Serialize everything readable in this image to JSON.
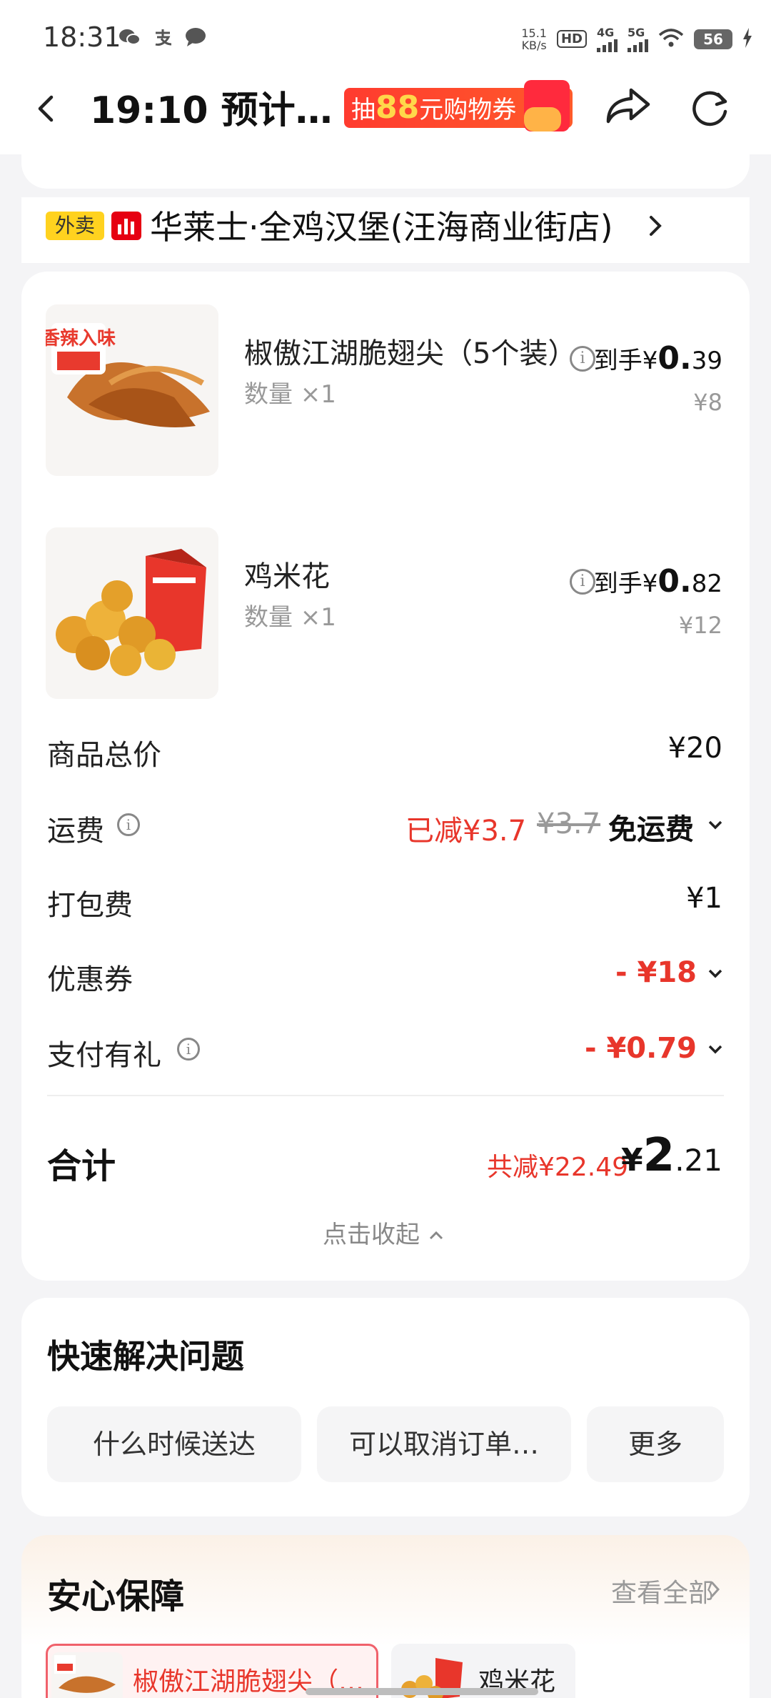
{
  "status_bar": {
    "time": "18:31",
    "net_speed_value": "15.1",
    "net_speed_unit": "KB/s",
    "hd_label": "HD",
    "sim1_label": "4G",
    "sim2_label": "5G",
    "battery": "56"
  },
  "nav": {
    "title": "19:10 预计…",
    "promo_prefix": "抽",
    "promo_number": "88",
    "promo_suffix": "元购物券"
  },
  "store": {
    "tag": "外卖",
    "name": "华莱士·全鸡汉堡(汪海商业街店)"
  },
  "items": [
    {
      "name": "椒傲江湖脆翅尖（5个装）",
      "qty": "数量 ×1",
      "price_prefix": "到手¥",
      "price_main": "0.",
      "price_decimal": "39",
      "original_price": "¥8",
      "image_badge": "香辣入味"
    },
    {
      "name": "鸡米花",
      "qty": "数量 ×1",
      "price_prefix": "到手¥",
      "price_main": "0.",
      "price_decimal": "82",
      "original_price": "¥12"
    }
  ],
  "fees": {
    "goods_total_label": "商品总价",
    "goods_total_value": "¥20",
    "delivery_label": "运费",
    "delivery_discount": "已减¥3.7",
    "delivery_original": "¥3.7",
    "delivery_value": "免运费",
    "packaging_label": "打包费",
    "packaging_value": "¥1",
    "coupon_label": "优惠券",
    "coupon_value": "- ¥18",
    "pay_gift_label": "支付有礼",
    "pay_gift_value": "- ¥0.79"
  },
  "total": {
    "label": "合计",
    "saved": "共减¥22.49",
    "currency": "¥",
    "integer": "2",
    "decimal": ".21",
    "collapse": "点击收起"
  },
  "faq": {
    "title": "快速解决问题",
    "chips": [
      "什么时候送达",
      "可以取消订单…",
      "更多"
    ]
  },
  "assurance": {
    "title": "安心保障",
    "view_all": "查看全部",
    "items": [
      "椒傲江湖脆翅尖（…",
      "鸡米花"
    ]
  },
  "colors": {
    "accent_red": "#e8362b",
    "tag_yellow": "#ffd21f",
    "background": "#f4f4f6"
  }
}
